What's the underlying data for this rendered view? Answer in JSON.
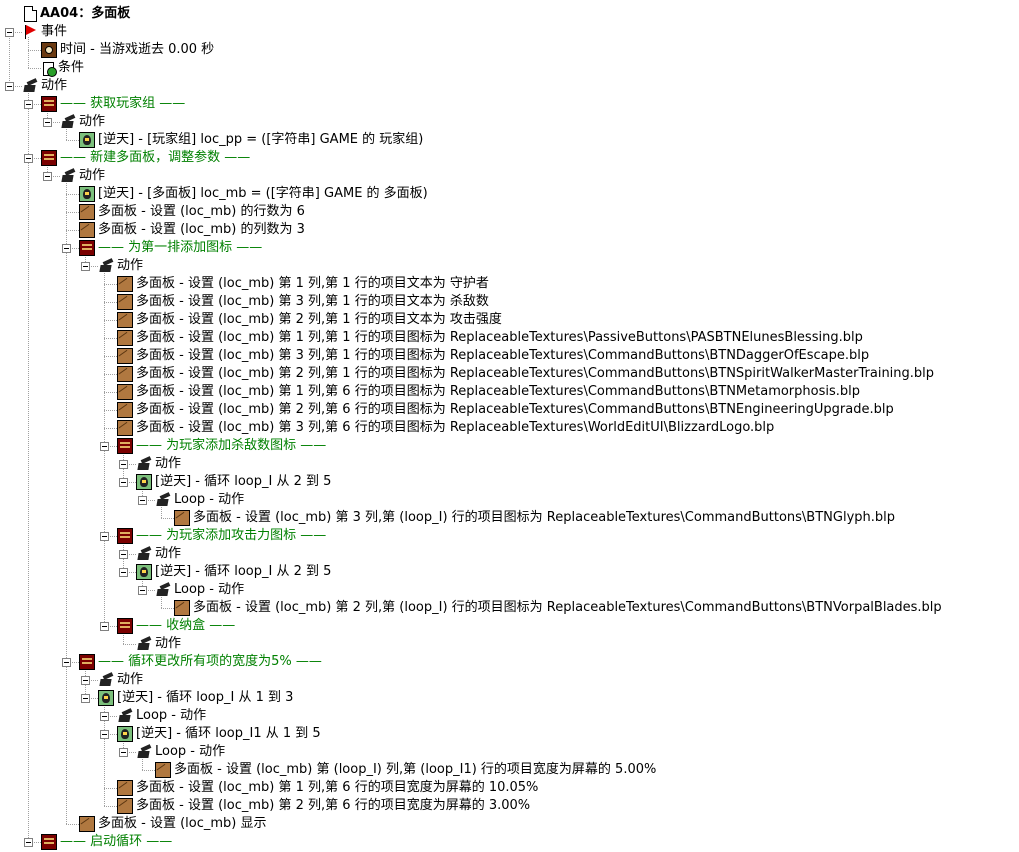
{
  "tree": {
    "nodes": [
      {
        "pm": false,
        "icon": "document-icon",
        "text": "AA04：多面板",
        "bold": true
      },
      {
        "pm": true,
        "icon": "event-flag-icon",
        "text": "事件"
      },
      {
        "pm": false,
        "icon": "timer-event-icon",
        "text": "时间 - 当游戏逝去 0.00 秒"
      },
      {
        "pm": false,
        "icon": "condition-icon",
        "text": "条件"
      },
      {
        "pm": true,
        "icon": "action-icon",
        "text": "动作"
      },
      {
        "pm": true,
        "icon": "comment-icon",
        "text": "—— 获取玩家组 ——",
        "comment": true
      },
      {
        "pm": true,
        "icon": "action-icon",
        "text": "动作"
      },
      {
        "pm": false,
        "icon": "custom-script-icon",
        "text": "[逆天] - [玩家组] loc_pp = ([字符串] GAME 的 玩家组)"
      },
      {
        "pm": true,
        "icon": "comment-icon",
        "text": "—— 新建多面板，调整参数 ——",
        "comment": true
      },
      {
        "pm": true,
        "icon": "action-icon",
        "text": "动作"
      },
      {
        "pm": false,
        "icon": "custom-script-icon",
        "text": "[逆天] - [多面板] loc_mb = ([字符串] GAME 的 多面板)"
      },
      {
        "pm": false,
        "icon": "multiboard-icon",
        "text": "多面板 - 设置 (loc_mb) 的行数为 6"
      },
      {
        "pm": false,
        "icon": "multiboard-icon",
        "text": "多面板 - 设置 (loc_mb) 的列数为 3"
      },
      {
        "pm": true,
        "icon": "comment-icon",
        "text": "—— 为第一排添加图标 ——",
        "comment": true
      },
      {
        "pm": true,
        "icon": "action-icon",
        "text": "动作"
      },
      {
        "pm": false,
        "icon": "multiboard-icon",
        "text": "多面板 - 设置 (loc_mb) 第 1 列,第 1 行的项目文本为 守护者"
      },
      {
        "pm": false,
        "icon": "multiboard-icon",
        "text": "多面板 - 设置 (loc_mb) 第 3 列,第 1 行的项目文本为 杀敌数"
      },
      {
        "pm": false,
        "icon": "multiboard-icon",
        "text": "多面板 - 设置 (loc_mb) 第 2 列,第 1 行的项目文本为 攻击强度"
      },
      {
        "pm": false,
        "icon": "multiboard-icon",
        "text": "多面板 - 设置 (loc_mb) 第 1 列,第 1 行的项目图标为 ReplaceableTextures\\PassiveButtons\\PASBTNElunesBlessing.blp"
      },
      {
        "pm": false,
        "icon": "multiboard-icon",
        "text": "多面板 - 设置 (loc_mb) 第 3 列,第 1 行的项目图标为 ReplaceableTextures\\CommandButtons\\BTNDaggerOfEscape.blp"
      },
      {
        "pm": false,
        "icon": "multiboard-icon",
        "text": "多面板 - 设置 (loc_mb) 第 2 列,第 1 行的项目图标为 ReplaceableTextures\\CommandButtons\\BTNSpiritWalkerMasterTraining.blp"
      },
      {
        "pm": false,
        "icon": "multiboard-icon",
        "text": "多面板 - 设置 (loc_mb) 第 1 列,第 6 行的项目图标为 ReplaceableTextures\\CommandButtons\\BTNMetamorphosis.blp"
      },
      {
        "pm": false,
        "icon": "multiboard-icon",
        "text": "多面板 - 设置 (loc_mb) 第 2 列,第 6 行的项目图标为 ReplaceableTextures\\CommandButtons\\BTNEngineeringUpgrade.blp"
      },
      {
        "pm": false,
        "icon": "multiboard-icon",
        "text": "多面板 - 设置 (loc_mb) 第 3 列,第 6 行的项目图标为 ReplaceableTextures\\WorldEditUI\\BlizzardLogo.blp"
      },
      {
        "pm": true,
        "icon": "comment-icon",
        "text": "—— 为玩家添加杀敌数图标 ——",
        "comment": true
      },
      {
        "pm": true,
        "icon": "action-icon",
        "text": "动作"
      },
      {
        "pm": true,
        "icon": "custom-script-icon",
        "text": "[逆天] - 循环 loop_I 从 2 到 5"
      },
      {
        "pm": true,
        "icon": "action-icon",
        "text": "Loop - 动作"
      },
      {
        "pm": false,
        "icon": "multiboard-icon",
        "text": "多面板 - 设置 (loc_mb) 第 3 列,第 (loop_I) 行的项目图标为 ReplaceableTextures\\CommandButtons\\BTNGlyph.blp"
      },
      {
        "pm": true,
        "icon": "comment-icon",
        "text": "—— 为玩家添加攻击力图标 ——",
        "comment": true
      },
      {
        "pm": true,
        "icon": "action-icon",
        "text": "动作"
      },
      {
        "pm": true,
        "icon": "custom-script-icon",
        "text": "[逆天] - 循环 loop_I 从 2 到 5"
      },
      {
        "pm": true,
        "icon": "action-icon",
        "text": "Loop - 动作"
      },
      {
        "pm": false,
        "icon": "multiboard-icon",
        "text": "多面板 - 设置 (loc_mb) 第 2 列,第 (loop_I) 行的项目图标为 ReplaceableTextures\\CommandButtons\\BTNVorpalBlades.blp"
      },
      {
        "pm": true,
        "icon": "comment-icon",
        "text": "—— 收纳盒 ——",
        "comment": true
      },
      {
        "pm": false,
        "icon": "action-icon",
        "text": "动作"
      },
      {
        "pm": true,
        "icon": "comment-icon",
        "text": "—— 循环更改所有项的宽度为5% ——",
        "comment": true
      },
      {
        "pm": true,
        "icon": "action-icon",
        "text": "动作"
      },
      {
        "pm": true,
        "icon": "custom-script-icon",
        "text": "[逆天] - 循环 loop_I 从 1 到 3"
      },
      {
        "pm": true,
        "icon": "action-icon",
        "text": "Loop - 动作"
      },
      {
        "pm": true,
        "icon": "custom-script-icon",
        "text": "[逆天] - 循环 loop_I1 从 1 到 5"
      },
      {
        "pm": true,
        "icon": "action-icon",
        "text": "Loop - 动作"
      },
      {
        "pm": false,
        "icon": "multiboard-icon",
        "text": "多面板 - 设置 (loc_mb) 第 (loop_I) 列,第 (loop_I1) 行的项目宽度为屏幕的 5.00%"
      },
      {
        "pm": false,
        "icon": "multiboard-icon",
        "text": "多面板 - 设置 (loc_mb) 第 1 列,第 6 行的项目宽度为屏幕的 10.05%"
      },
      {
        "pm": false,
        "icon": "multiboard-icon",
        "text": "多面板 - 设置 (loc_mb) 第 2 列,第 6 行的项目宽度为屏幕的 3.00%"
      },
      {
        "pm": false,
        "icon": "multiboard-icon",
        "text": "多面板 - 设置 (loc_mb) 显示"
      },
      {
        "pm": true,
        "icon": "comment-icon",
        "text": "—— 启动循环 ——",
        "comment": true
      }
    ]
  }
}
